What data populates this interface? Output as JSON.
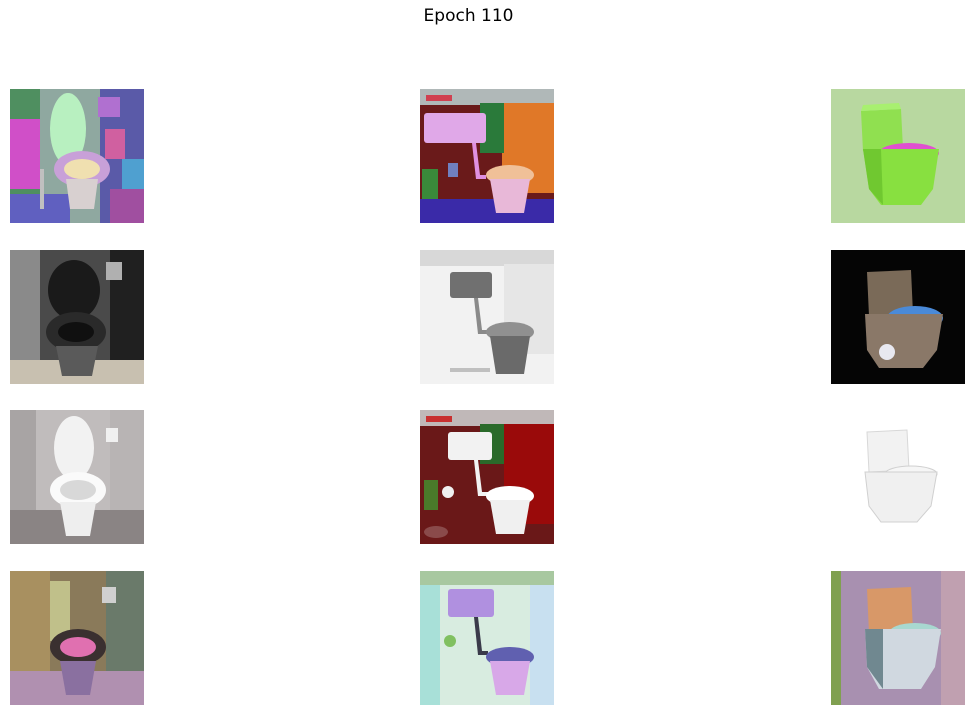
{
  "figure": {
    "title": "Epoch 110"
  },
  "grid": {
    "rows": 4,
    "columns": 3,
    "images": [
      [
        "toilet-image-colorized-bathroom",
        "toilet-image-colorized-red-wall",
        "toilet-image-colorized-green-product"
      ],
      [
        "toilet-image-grayscale-bathroom",
        "toilet-image-grayscale-red-wall",
        "toilet-image-grayscale-product"
      ],
      [
        "toilet-image-original-bathroom",
        "toilet-image-original-red-wall",
        "toilet-image-original-product"
      ],
      [
        "toilet-image-generated-bathroom",
        "toilet-image-generated-red-wall",
        "toilet-image-generated-product"
      ]
    ]
  }
}
